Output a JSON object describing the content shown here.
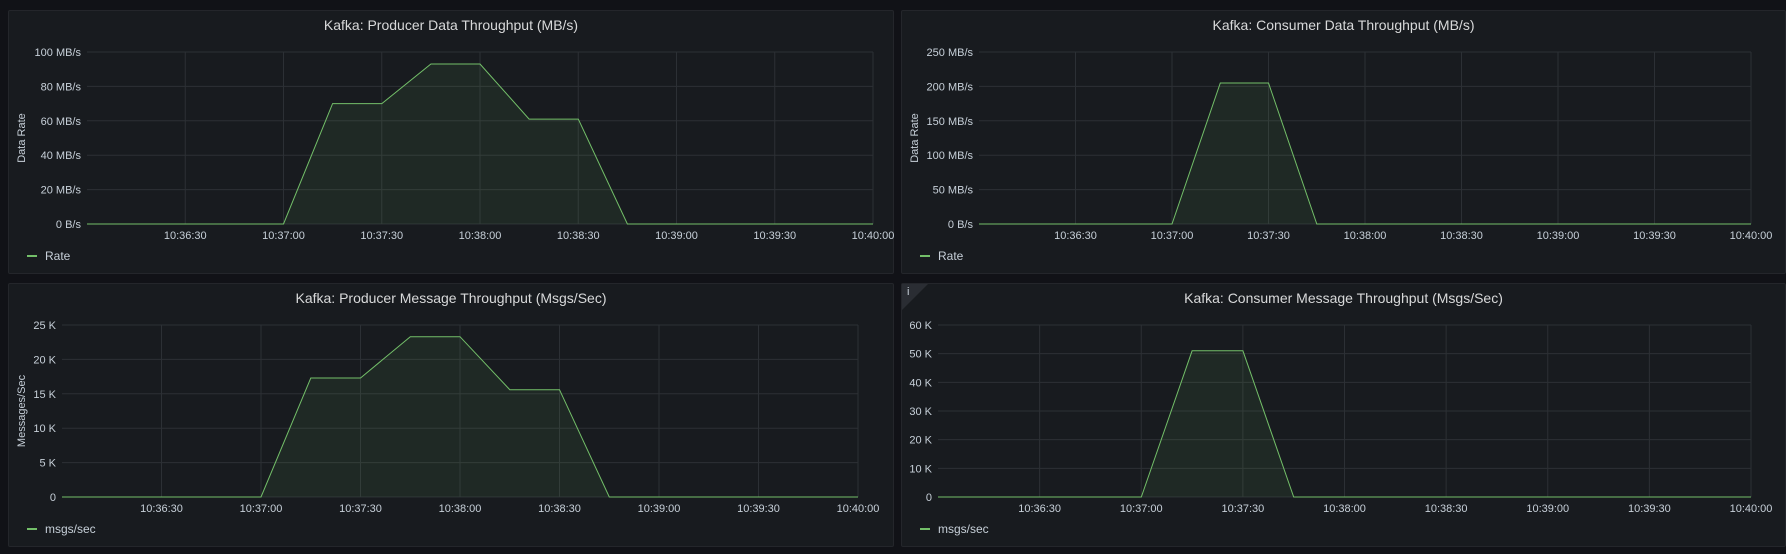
{
  "legend_color": "#73bf69",
  "fill_color": "rgba(115,191,105,0.09)",
  "grid_color": "#2c3035",
  "panels": [
    {
      "title": "Kafka: Producer Data Throughput (MB/s)",
      "legend": "Rate",
      "info": ""
    },
    {
      "title": "Kafka: Consumer Data Throughput (MB/s)",
      "legend": "Rate",
      "info": ""
    },
    {
      "title": "Kafka: Producer Message Throughput (Msgs/Sec)",
      "legend": "msgs/sec",
      "info": ""
    },
    {
      "title": "Kafka: Consumer Message Throughput (Msgs/Sec)",
      "legend": "msgs/sec",
      "info": "i"
    }
  ],
  "chart_data": [
    {
      "type": "area",
      "title": "Kafka: Producer Data Throughput (MB/s)",
      "ylabel": "Data Rate",
      "ylim": [
        0,
        100
      ],
      "yticks": [
        0,
        20,
        40,
        60,
        80,
        100
      ],
      "ytick_labels": [
        "0 B/s",
        "20 MB/s",
        "40 MB/s",
        "60 MB/s",
        "80 MB/s",
        "100 MB/s"
      ],
      "xlim": [
        "10:36:00",
        "10:40:00"
      ],
      "xtick_labels": [
        "10:36:30",
        "10:37:00",
        "10:37:30",
        "10:38:00",
        "10:38:30",
        "10:39:00",
        "10:39:30",
        "10:40:00"
      ],
      "series": [
        {
          "name": "Rate",
          "x": [
            "10:36:00",
            "10:37:00",
            "10:37:15",
            "10:37:30",
            "10:37:45",
            "10:38:00",
            "10:38:15",
            "10:38:30",
            "10:38:45",
            "10:40:00"
          ],
          "values": [
            0,
            0,
            70,
            70,
            93,
            93,
            61,
            61,
            0,
            0
          ]
        }
      ]
    },
    {
      "type": "area",
      "title": "Kafka: Consumer Data Throughput (MB/s)",
      "ylabel": "Data Rate",
      "ylim": [
        0,
        250
      ],
      "yticks": [
        0,
        50,
        100,
        150,
        200,
        250
      ],
      "ytick_labels": [
        "0 B/s",
        "50 MB/s",
        "100 MB/s",
        "150 MB/s",
        "200 MB/s",
        "250 MB/s"
      ],
      "xlim": [
        "10:36:00",
        "10:40:00"
      ],
      "xtick_labels": [
        "10:36:30",
        "10:37:00",
        "10:37:30",
        "10:38:00",
        "10:38:30",
        "10:39:00",
        "10:39:30",
        "10:40:00"
      ],
      "series": [
        {
          "name": "Rate",
          "x": [
            "10:36:00",
            "10:37:00",
            "10:37:15",
            "10:37:30",
            "10:37:45",
            "10:40:00"
          ],
          "values": [
            0,
            0,
            205,
            205,
            0,
            0
          ]
        }
      ]
    },
    {
      "type": "area",
      "title": "Kafka: Producer Message Throughput (Msgs/Sec)",
      "ylabel": "Messages/Sec",
      "ylim": [
        0,
        25000
      ],
      "yticks": [
        0,
        5000,
        10000,
        15000,
        20000,
        25000
      ],
      "ytick_labels": [
        "0",
        "5 K",
        "10 K",
        "15 K",
        "20 K",
        "25 K"
      ],
      "xlim": [
        "10:36:00",
        "10:40:00"
      ],
      "xtick_labels": [
        "10:36:30",
        "10:37:00",
        "10:37:30",
        "10:38:00",
        "10:38:30",
        "10:39:00",
        "10:39:30",
        "10:40:00"
      ],
      "series": [
        {
          "name": "msgs/sec",
          "x": [
            "10:36:00",
            "10:37:00",
            "10:37:15",
            "10:37:30",
            "10:37:45",
            "10:38:00",
            "10:38:15",
            "10:38:30",
            "10:38:45",
            "10:40:00"
          ],
          "values": [
            0,
            0,
            17300,
            17300,
            23300,
            23300,
            15600,
            15600,
            0,
            0
          ]
        }
      ]
    },
    {
      "type": "area",
      "title": "Kafka: Consumer Message Throughput (Msgs/Sec)",
      "ylabel": "",
      "ylim": [
        0,
        60000
      ],
      "yticks": [
        0,
        10000,
        20000,
        30000,
        40000,
        50000,
        60000
      ],
      "ytick_labels": [
        "0",
        "10 K",
        "20 K",
        "30 K",
        "40 K",
        "50 K",
        "60 K"
      ],
      "xlim": [
        "10:36:00",
        "10:40:00"
      ],
      "xtick_labels": [
        "10:36:30",
        "10:37:00",
        "10:37:30",
        "10:38:00",
        "10:38:30",
        "10:39:00",
        "10:39:30",
        "10:40:00"
      ],
      "series": [
        {
          "name": "msgs/sec",
          "x": [
            "10:36:00",
            "10:37:00",
            "10:37:15",
            "10:37:30",
            "10:37:45",
            "10:40:00"
          ],
          "values": [
            0,
            0,
            51000,
            51000,
            0,
            0
          ]
        }
      ]
    }
  ]
}
